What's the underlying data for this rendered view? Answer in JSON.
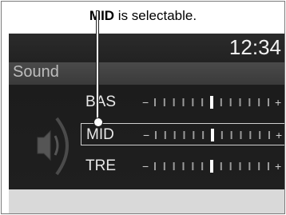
{
  "caption": {
    "bold": "MID",
    "rest": " is selectable."
  },
  "clock": "12:34",
  "screen_title": "Sound",
  "rows": [
    {
      "label": "BAS",
      "value": 0.5,
      "minus": "−",
      "plus": "+"
    },
    {
      "label": "MID",
      "value": 0.5,
      "minus": "−",
      "plus": "+"
    },
    {
      "label": "TRE",
      "value": 0.5,
      "minus": "−",
      "plus": "+"
    }
  ],
  "icons": {
    "speaker": "speaker-icon"
  }
}
